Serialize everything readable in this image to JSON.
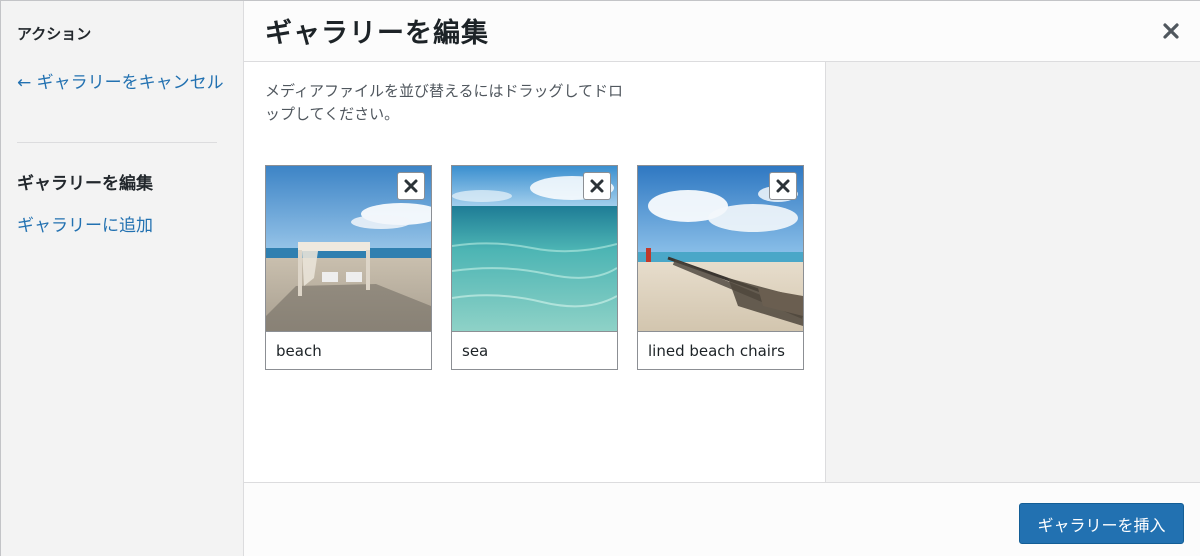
{
  "sidebar": {
    "heading": "アクション",
    "cancel_link": "← ギャラリーをキャンセル",
    "items": [
      {
        "label": "ギャラリーを編集"
      },
      {
        "label": "ギャラリーに追加"
      }
    ]
  },
  "header": {
    "title": "ギャラリーを編集",
    "close_icon": "close-icon"
  },
  "content": {
    "instructions": "メディアファイルを並び替えるにはドラッグしてドロップしてください。",
    "images": [
      {
        "caption": "beach",
        "remove_icon": "remove-icon"
      },
      {
        "caption": "sea",
        "remove_icon": "remove-icon"
      },
      {
        "caption": "lined beach chairs",
        "remove_icon": "remove-icon"
      }
    ]
  },
  "footer": {
    "insert_label": "ギャラリーを挿入"
  },
  "colors": {
    "accent": "#2271b1",
    "sidebar_bg": "#f3f3f3"
  }
}
